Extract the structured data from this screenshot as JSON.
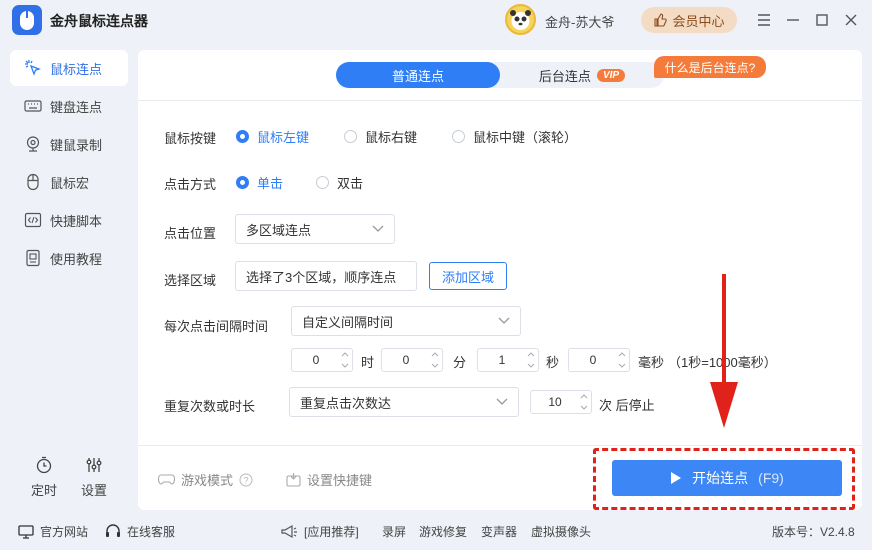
{
  "app": {
    "title": "金舟鼠标连点器",
    "accent": "#2f7ef5"
  },
  "header": {
    "username": "金舟-苏大爷",
    "vip_center": "会员中心"
  },
  "sidebar": {
    "items": [
      {
        "label": "鼠标连点",
        "icon": "cursor-click-icon",
        "active": true
      },
      {
        "label": "键盘连点",
        "icon": "keyboard-icon",
        "active": false
      },
      {
        "label": "键鼠录制",
        "icon": "webcam-record-icon",
        "active": false
      },
      {
        "label": "鼠标宏",
        "icon": "mouse-icon",
        "active": false
      },
      {
        "label": "快捷脚本",
        "icon": "code-script-icon",
        "active": false
      },
      {
        "label": "使用教程",
        "icon": "document-icon",
        "active": false
      }
    ],
    "timer": "定时",
    "settings": "设置"
  },
  "tabs": {
    "normal": "普通连点",
    "background": "后台连点",
    "vip": "VIP",
    "tip": "什么是后台连点?"
  },
  "form": {
    "mouse_button": {
      "label": "鼠标按键",
      "options": [
        "鼠标左键",
        "鼠标右键",
        "鼠标中键（滚轮）"
      ],
      "selected": "鼠标左键"
    },
    "click_type": {
      "label": "点击方式",
      "options": [
        "单击",
        "双击"
      ],
      "selected": "单击"
    },
    "click_position": {
      "label": "点击位置",
      "value": "多区域连点"
    },
    "select_area": {
      "label": "选择区域",
      "value": "选择了3个区域，顺序连点",
      "button": "添加区域"
    },
    "interval": {
      "label": "每次点击间隔时间",
      "mode": "自定义间隔时间",
      "hours": "0",
      "hours_unit": "时",
      "minutes": "0",
      "minutes_unit": "分",
      "seconds": "1",
      "seconds_unit": "秒",
      "ms": "0",
      "ms_unit": "毫秒",
      "note": "（1秒=1000毫秒）"
    },
    "repeat": {
      "label": "重复次数或时长",
      "mode": "重复点击次数达",
      "count": "10",
      "suffix": "次 后停止"
    }
  },
  "footer": {
    "game_mode": "游戏模式",
    "hotkey_setting": "设置快捷键",
    "start": "开始连点",
    "start_hotkey": "(F9)"
  },
  "bottom": {
    "website": "官方网站",
    "service": "在线客服",
    "recommend": "[应用推荐]",
    "apps": [
      "录屏",
      "游戏修复",
      "变声器",
      "虚拟摄像头"
    ],
    "version": "版本号：V2.4.8"
  }
}
